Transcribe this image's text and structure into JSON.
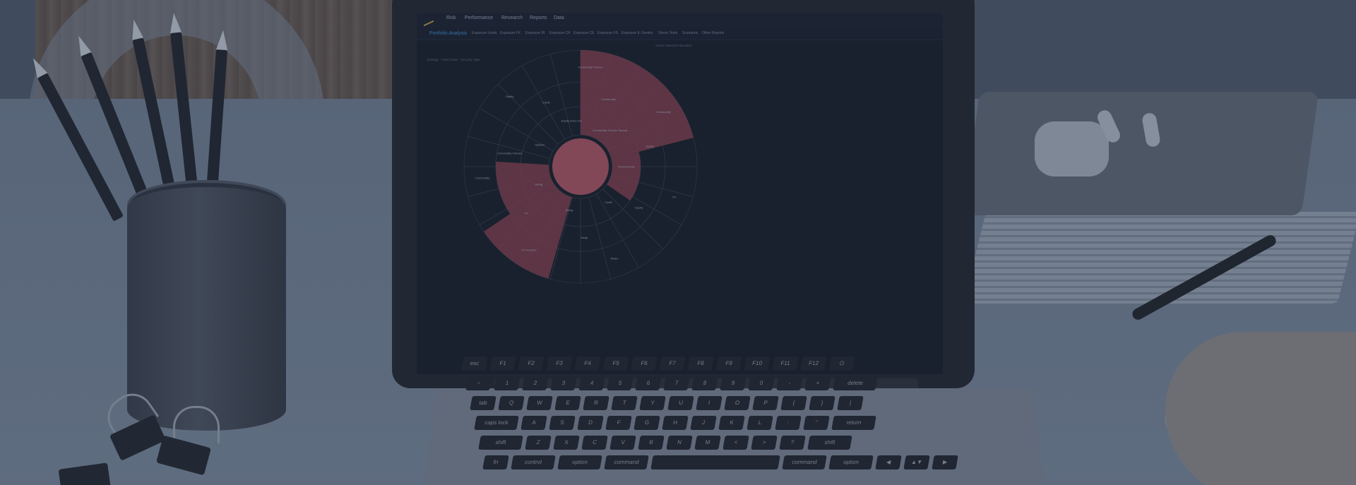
{
  "app": {
    "menu": [
      "Risk",
      "Performance",
      "Research",
      "Reports",
      "Data"
    ],
    "active_tab": "Portfolio Analysis",
    "tabs": [
      "Exposure Limits",
      "Exposure FX",
      "Exposure IR",
      "Exposure CR",
      "Exposure CE",
      "Exposure FS",
      "Exposure IL",
      "Greeks",
      "Stress Tests",
      "Scenarios",
      "Other Reports"
    ],
    "breadcrumb": "Strategy · Asset Class · Security Type",
    "top_right": "Scene Selected Allocation"
  },
  "sunburst_labels": [
    "Commodity Futures",
    "Commodity",
    "Commodity Futures Spread",
    "Commodity",
    "Equity",
    "Fixed Income",
    "FX",
    "Equity",
    "Credit",
    "Rates",
    "Swap",
    "Swing",
    "FX Forward",
    "FX",
    "Swing",
    "Commodity",
    "Commodity Futures",
    "Options",
    "Equity",
    "Credit",
    "Equity Index Fut"
  ],
  "colors": {
    "highlight": "#8b3a45",
    "screen": "#0f141d",
    "tab_active": "#3a8dd0"
  },
  "keyboard": {
    "row1": [
      "esc",
      "F1",
      "F2",
      "F3",
      "F4",
      "F5",
      "F6",
      "F7",
      "F8",
      "F9",
      "F10",
      "F11",
      "F12",
      "⏻"
    ],
    "row2": [
      "~",
      "1",
      "2",
      "3",
      "4",
      "5",
      "6",
      "7",
      "8",
      "9",
      "0",
      "-",
      "+",
      "delete"
    ],
    "row3": [
      "tab",
      "Q",
      "W",
      "E",
      "R",
      "T",
      "Y",
      "U",
      "I",
      "O",
      "P",
      "{",
      "}",
      "|"
    ],
    "row4": [
      "caps lock",
      "A",
      "S",
      "D",
      "F",
      "G",
      "H",
      "J",
      "K",
      "L",
      ":",
      "\"",
      "return"
    ],
    "row5": [
      "shift",
      "Z",
      "X",
      "C",
      "V",
      "B",
      "N",
      "M",
      "<",
      ">",
      "?",
      "shift"
    ],
    "row6": [
      "fn",
      "control",
      "option",
      "command",
      "",
      "command",
      "option",
      "◀",
      "▲▼",
      "▶"
    ]
  }
}
